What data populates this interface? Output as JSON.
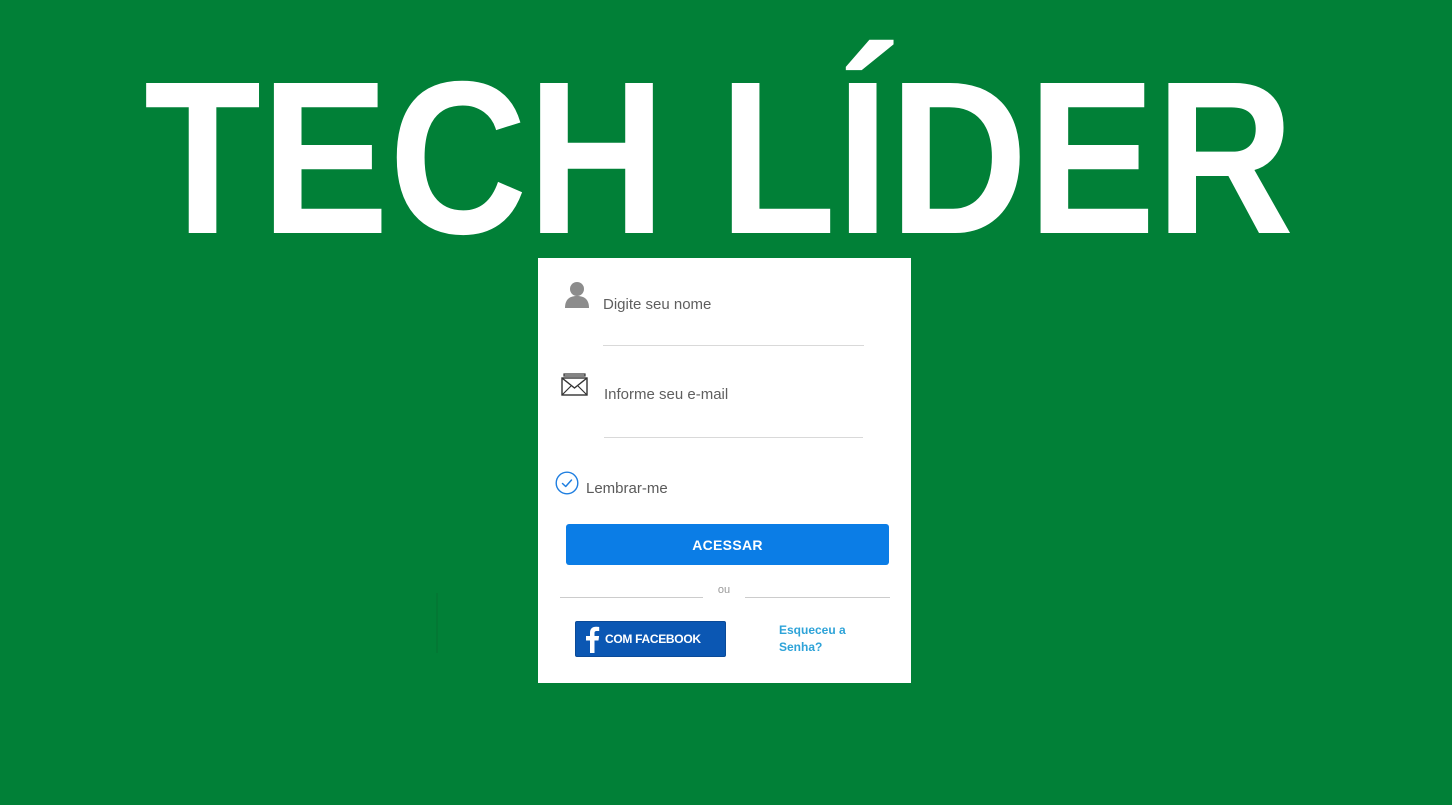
{
  "window": {
    "background_color": "#018037"
  },
  "brand": {
    "logo_text": "TECH LÍDER",
    "logo_color": "#ffffff"
  },
  "login": {
    "name_field": {
      "placeholder": "Digite seu nome",
      "value": "",
      "icon": "user-icon"
    },
    "email_field": {
      "placeholder": "Informe seu e-mail",
      "value": "",
      "icon": "envelope-icon"
    },
    "remember": {
      "label": "Lembrar-me",
      "checked": true,
      "icon": "check-circle-icon"
    },
    "submit": {
      "label": "ACESSAR",
      "color": "#0b7de6"
    },
    "divider": {
      "label": "ou"
    },
    "facebook": {
      "label": "COM FACEBOOK",
      "icon": "facebook-icon",
      "color": "#0b57b3"
    },
    "forgot_password": {
      "label": "Esqueceu a Senha?",
      "color": "#2ea3d8"
    }
  }
}
